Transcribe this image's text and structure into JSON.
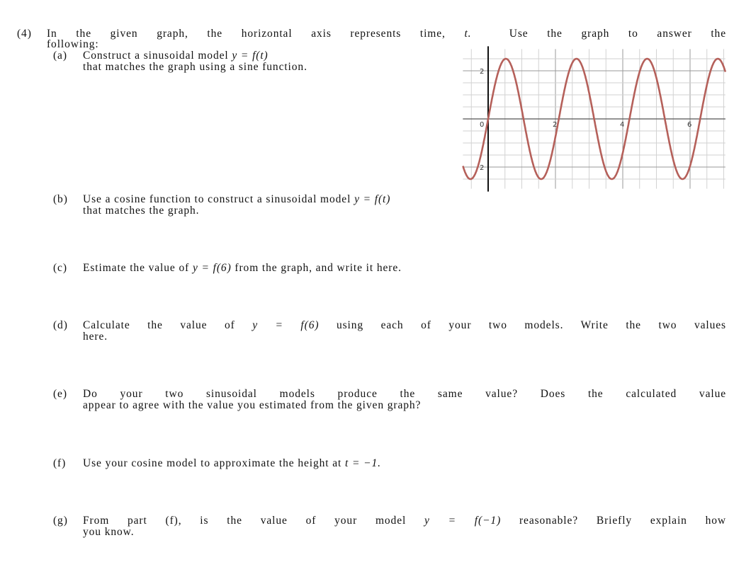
{
  "problem": {
    "number": "(4)",
    "intro_line1": "In the given graph, the horizontal axis represents time,",
    "intro_var": "t.",
    "intro_line1b": "Use the graph to answer the",
    "intro_line2": "following:"
  },
  "parts": {
    "a": {
      "label": "(a)",
      "l1": "Construct a sinusoidal model",
      "math": "y = f(t)",
      "l2": "that matches the graph using a sine function."
    },
    "b": {
      "label": "(b)",
      "l1": "Use a cosine function to construct a sinusoidal model",
      "math": "y = f(t)",
      "l2": "that matches the graph."
    },
    "c": {
      "label": "(c)",
      "l1": "Estimate the value of",
      "math": "y = f(6)",
      "l1b": "from the graph, and write it here."
    },
    "d": {
      "label": "(d)",
      "l1": "Calculate the value of",
      "math": "y = f(6)",
      "l1b": "using each of your two models.  Write the two values",
      "l2": "here."
    },
    "e": {
      "label": "(e)",
      "l1": "Do your two sinusoidal models produce the same value?  Does the calculated value",
      "l2": "appear to agree with the value you estimated from the given graph?"
    },
    "f": {
      "label": "(f)",
      "l1": "Use your cosine model to approximate the height at",
      "math": "t = −1."
    },
    "g": {
      "label": "(g)",
      "l1": "From part (f), is the value of your model",
      "math": "y = f(−1)",
      "l1b": "reasonable?  Briefly explain how",
      "l2": "you know."
    }
  },
  "chart_data": {
    "type": "line",
    "title": "",
    "xlabel": "",
    "ylabel": "",
    "xlim": [
      -0.75,
      7.05
    ],
    "ylim": [
      -2.9,
      2.9
    ],
    "grid": true,
    "grid_step": 0.5,
    "x_ticks": [
      "0",
      "2",
      "4",
      "6"
    ],
    "y_ticks": [
      "2",
      "-2"
    ],
    "series": [
      {
        "function": "2.5 sin(2πt / 2.1)",
        "amplitude": 2.5,
        "period": 2.1,
        "color": "#b5605a"
      }
    ]
  }
}
